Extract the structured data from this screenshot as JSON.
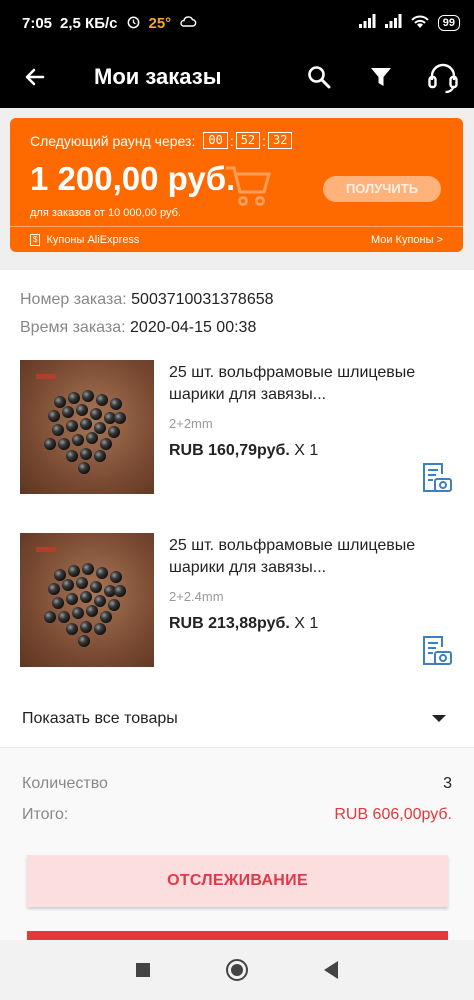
{
  "status_bar": {
    "time": "7:05",
    "network_speed": "2,5 КБ/с",
    "temperature": "25°",
    "battery": "99",
    "icons": [
      "alarm-icon",
      "cloud-icon",
      "signal-icon",
      "signal-icon",
      "wifi-icon",
      "battery-icon"
    ]
  },
  "app_bar": {
    "title": "Мои заказы",
    "icons": [
      "back-arrow-icon",
      "search-icon",
      "filter-icon",
      "headset-icon"
    ]
  },
  "promo": {
    "timer_label": "Следующий раунд через:",
    "timer": [
      "00",
      "52",
      "32"
    ],
    "amount": "1 200,00 руб.",
    "button_label": "ПОЛУЧИТЬ",
    "subtitle": "для заказов от 10 000,00 руб.",
    "coupons_label": "Купоны AliExpress",
    "my_coupons": "Мои Купоны >",
    "colors": {
      "background": "#ff6a00"
    }
  },
  "order": {
    "number_label": "Номер заказа:",
    "number": "5003710031378658",
    "time_label": "Время заказа:",
    "time": "2020-04-15 00:38"
  },
  "products": [
    {
      "name": "25 шт. вольфрамовые шлицевые шарики для завязы...",
      "variant": "2+2mm",
      "price": "RUB 160,79руб.",
      "quantity": "X 1"
    },
    {
      "name": "25 шт. вольфрамовые шлицевые шарики для завязы...",
      "variant": "2+2.4mm",
      "price": "RUB 213,88руб.",
      "quantity": "X 1"
    }
  ],
  "show_all": {
    "label": "Показать все товары"
  },
  "totals": {
    "quantity_label": "Количество",
    "quantity": "3",
    "total_label": "Итого:",
    "total": "RUB 606,00руб.",
    "colors": {
      "total": "#e5383b"
    }
  },
  "actions": {
    "track_label": "ОТСЛЕЖИВАНИЕ"
  }
}
